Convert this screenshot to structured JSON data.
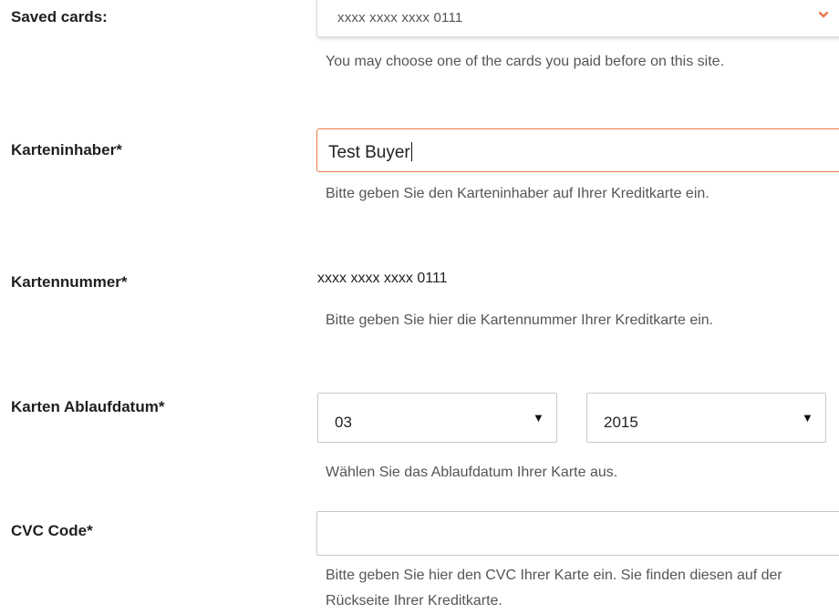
{
  "saved_cards": {
    "label": "Saved cards:",
    "selected": "xxxx xxxx xxxx 0111",
    "help": "You may choose one of the cards you paid before on this site."
  },
  "holder": {
    "label": "Karteninhaber*",
    "value": "Test Buyer",
    "help": "Bitte geben Sie den Karteninhaber auf Ihrer Kreditkarte ein."
  },
  "card_number": {
    "label": "Kartennummer*",
    "value": "xxxx xxxx xxxx 0111",
    "help": "Bitte geben Sie hier die Kartennummer Ihrer Kreditkarte ein."
  },
  "expiry": {
    "label": "Karten Ablaufdatum*",
    "month": "03",
    "year": "2015",
    "help": "Wählen Sie das Ablaufdatum Ihrer Karte aus."
  },
  "cvc": {
    "label": "CVC Code*",
    "value": "",
    "help": "Bitte geben Sie hier den CVC Ihrer Karte ein. Sie finden diesen auf der Rückseite Ihrer Kreditkarte."
  },
  "icons": {
    "saved_select": "chevron-down-icon",
    "month_select": "triangle-down-icon",
    "year_select": "triangle-down-icon"
  },
  "colors": {
    "accent": "#e57a45",
    "label": "#1f1f1f",
    "help_text": "#555555",
    "border": "#c9c9c9"
  }
}
